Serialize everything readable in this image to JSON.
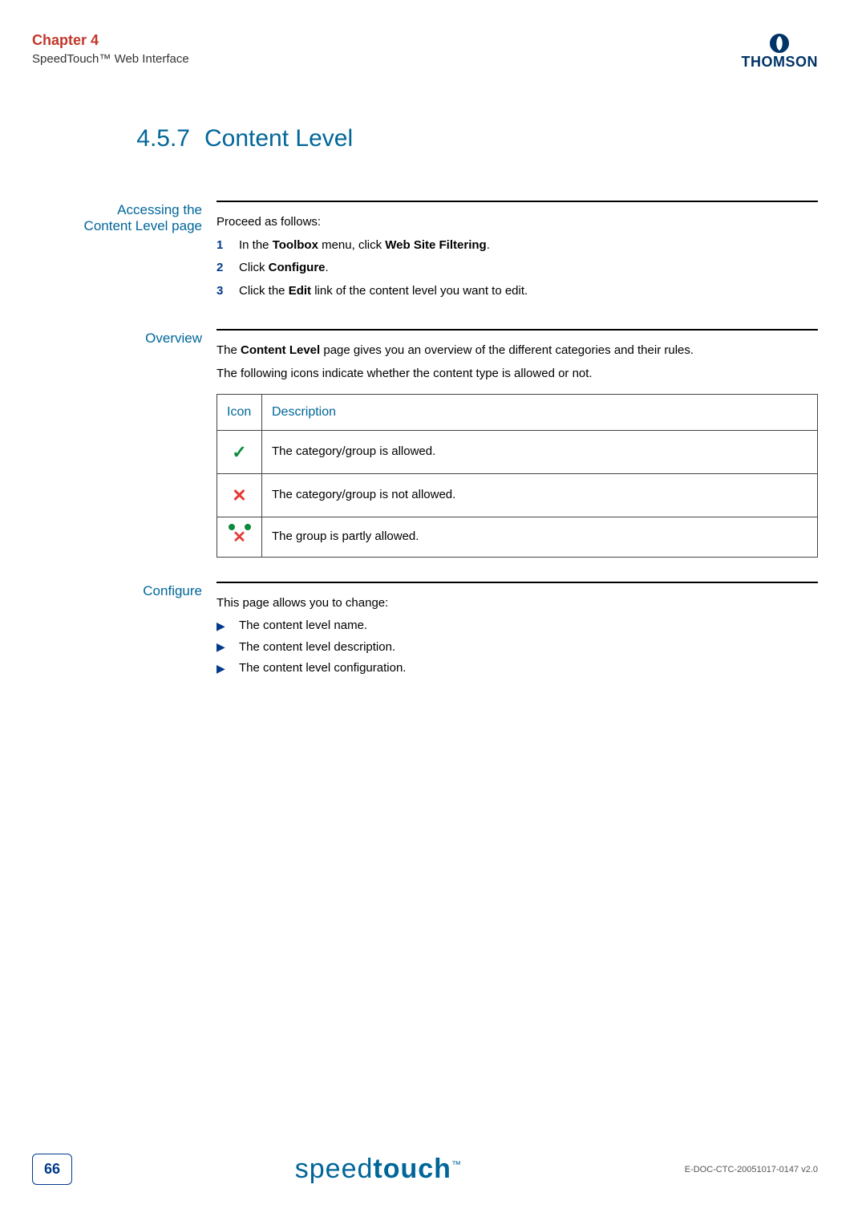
{
  "header": {
    "chapter": "Chapter 4",
    "subtitle": "SpeedTouch™ Web Interface",
    "brand": "THOMSON"
  },
  "section": {
    "number": "4.5.7",
    "title": "Content Level"
  },
  "accessing": {
    "label": "Accessing the Content Level page",
    "intro": "Proceed as follows:",
    "steps": [
      {
        "num": "1",
        "pre": "In the ",
        "bold1": "Toolbox",
        "mid": " menu, click ",
        "bold2": "Web Site Filtering",
        "post": "."
      },
      {
        "num": "2",
        "pre": "Click ",
        "bold1": "Configure",
        "mid": "",
        "bold2": "",
        "post": "."
      },
      {
        "num": "3",
        "pre": "Click the ",
        "bold1": "Edit",
        "mid": " link of the content level you want to edit.",
        "bold2": "",
        "post": ""
      }
    ]
  },
  "overview": {
    "label": "Overview",
    "p1_pre": "The ",
    "p1_bold": "Content Level",
    "p1_post": " page gives you an overview of the different categories and their rules.",
    "p2": "The following icons indicate whether the content type is allowed or not.",
    "table": {
      "h1": "Icon",
      "h2": "Description",
      "rows": [
        {
          "icon": "check",
          "desc": "The category/group is allowed."
        },
        {
          "icon": "cross",
          "desc": "The category/group is not allowed."
        },
        {
          "icon": "partial",
          "desc": "The group is partly allowed."
        }
      ]
    }
  },
  "configure": {
    "label": "Configure",
    "intro": "This page allows you to change:",
    "items": [
      "The content level name.",
      "The content level description.",
      "The content level configuration."
    ]
  },
  "footer": {
    "pagenum": "66",
    "logo_light": "speed",
    "logo_bold": "touch",
    "logo_tm": "™",
    "docid": "E-DOC-CTC-20051017-0147 v2.0"
  }
}
